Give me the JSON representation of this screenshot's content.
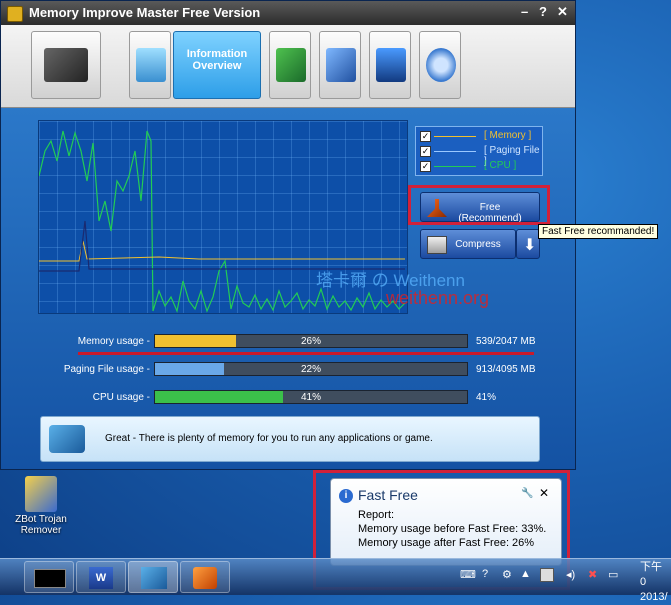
{
  "window": {
    "title": "Memory Improve Master Free Version",
    "minimize": "–",
    "help": "?",
    "close": "✕"
  },
  "toolbar": {
    "active_tab_line1": "Information",
    "active_tab_line2": "Overview"
  },
  "legend": [
    {
      "label": "[ Memory ]",
      "color": "#f0c030"
    },
    {
      "label": "[ Paging File ]",
      "color": "#5aa0ff"
    },
    {
      "label": "[ CPU ]",
      "color": "#22cc55"
    }
  ],
  "buttons": {
    "free_label": "Free (Recommend)",
    "compress_label": "Compress"
  },
  "tooltip": "Fast Free recommanded!",
  "watermark": {
    "line1": "塔卡爾 の Weithenn",
    "line2": "weithenn.org"
  },
  "meters": [
    {
      "label": "Memory usage -",
      "percent_text": "26%",
      "percent": 26,
      "value": "539/2047 MB",
      "color": "#f0c030"
    },
    {
      "label": "Paging File usage -",
      "percent_text": "22%",
      "percent": 22,
      "value": "913/4095 MB",
      "color": "#6aa8e8"
    },
    {
      "label": "CPU usage -",
      "percent_text": "41%",
      "percent": 41,
      "value": "41%",
      "color": "#3bc04a"
    }
  ],
  "status_message": "Great - There is plenty of memory for you to run any applications or game.",
  "desktop_icon": {
    "line1": "ZBot Trojan",
    "line2": "Remover"
  },
  "balloon": {
    "title": "Fast Free",
    "line1": "Report:",
    "line2": "Memory usage before Fast Free: 33%.",
    "line3": "Memory usage after Fast Free: 26%",
    "close": "✕"
  },
  "taskbar": {
    "clock_line1": "下午 0",
    "clock_line2": "2013/"
  }
}
